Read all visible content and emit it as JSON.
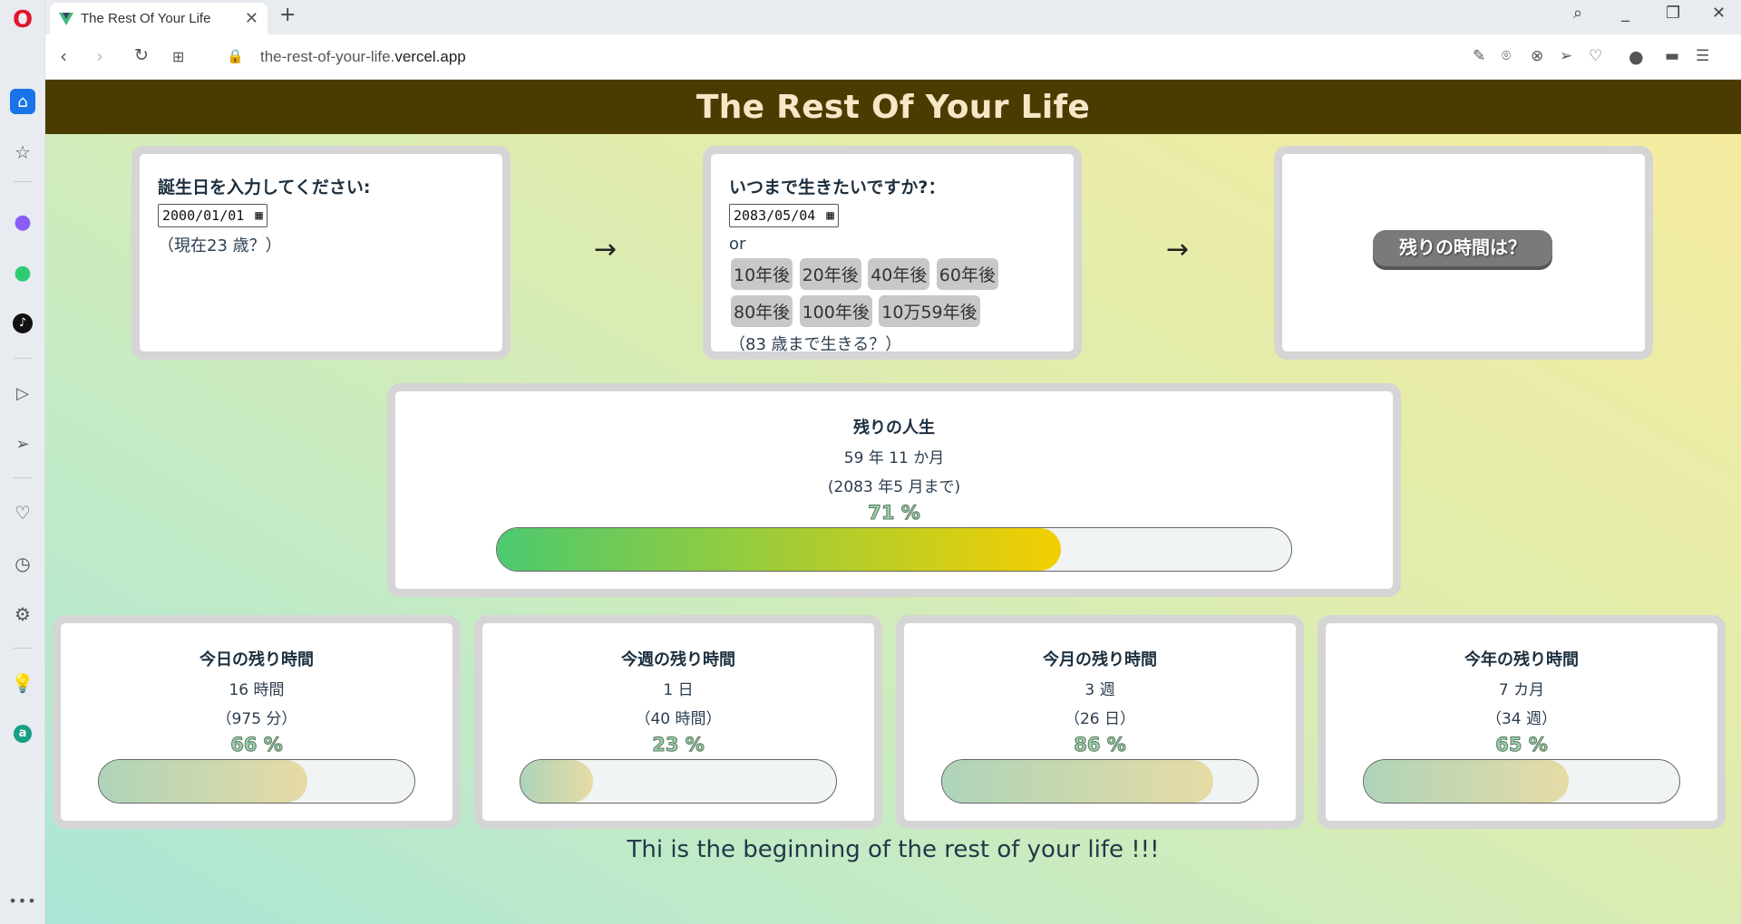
{
  "browser": {
    "tab_title": "The Rest Of Your Life",
    "url_path": "the-rest-of-your-life.",
    "url_domain": "vercel.app"
  },
  "page": {
    "title": "The Rest Of Your Life",
    "birth": {
      "label": "誕生日を入力してください:",
      "value": "2000/01/01",
      "note": "（現在23 歳？）"
    },
    "target": {
      "label": "いつまで生きたいですか?：",
      "value": "2083/05/04",
      "or": "or",
      "quick_options": [
        "10年後",
        "20年後",
        "40年後",
        "60年後",
        "80年後",
        "100年後",
        "10万59年後"
      ],
      "note": "（83 歳まで生きる？）"
    },
    "arrow": "→",
    "go_button": "残りの時間は？",
    "life": {
      "title": "残りの人生",
      "line1": "59 年 11 か月",
      "line2": "(2083 年5 月まで)",
      "percent_label": "71 %",
      "percent": 71
    },
    "periods": [
      {
        "title": "今日の残り時間",
        "line1": "16 時間",
        "line2": "（975 分）",
        "percent_label": "66 %",
        "percent": 66
      },
      {
        "title": "今週の残り時間",
        "line1": "1 日",
        "line2": "（40 時間）",
        "percent_label": "23 %",
        "percent": 23
      },
      {
        "title": "今月の残り時間",
        "line1": "3 週",
        "line2": "（26 日）",
        "percent_label": "86 %",
        "percent": 86
      },
      {
        "title": "今年の残り時間",
        "line1": "7 カ月",
        "line2": "（34 週）",
        "percent_label": "65 %",
        "percent": 65
      }
    ],
    "footer": "Thi is the beginning of the rest of your life !!!"
  },
  "colors": {
    "header_bg": "#4a3c00",
    "life_bar_start": "#4cc96f",
    "life_bar_end": "#f4cf00",
    "period_bar_start": "#aed4b9",
    "period_bar_end": "#e6dba5"
  },
  "icons": {
    "sidebar": [
      "opera-logo-icon",
      "home-icon",
      "star-icon",
      "messenger-icon",
      "whatsapp-icon",
      "tiktok-icon",
      "player-icon",
      "send-icon",
      "heart-icon",
      "history-icon",
      "settings-icon",
      "bulb-icon",
      "aria-icon",
      "more-icon"
    ]
  }
}
